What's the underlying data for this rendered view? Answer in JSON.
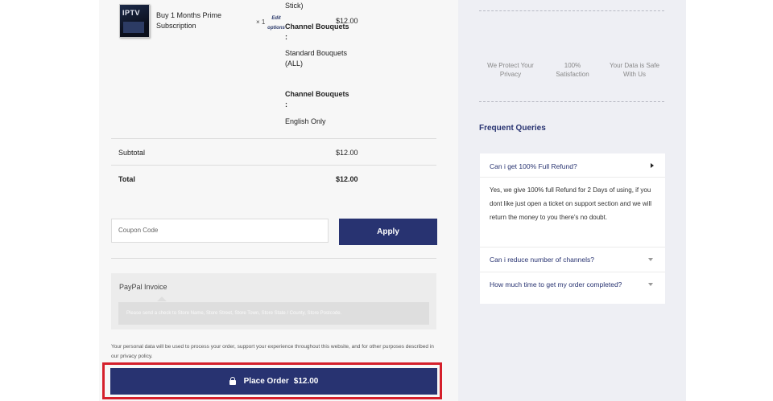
{
  "cart": {
    "product_image_text": "IPTV",
    "product_name": "Buy 1 Months Prime Subscription",
    "quantity": "× 1",
    "edit_options": "Edit options",
    "price": "$12.00",
    "meta_top": "Stick)",
    "meta_label_1": "Channel Bouquets :",
    "meta_value_1": "Standard Bouquets (ALL)",
    "meta_label_2": "Channel Bouquets :",
    "meta_value_2": "English Only"
  },
  "totals": {
    "subtotal_label": "Subtotal",
    "subtotal_value": "$12.00",
    "total_label": "Total",
    "total_value": "$12.00"
  },
  "coupon": {
    "placeholder": "Coupon Code",
    "apply_label": "Apply"
  },
  "payment": {
    "method_label": "PayPal Invoice",
    "instruction": "Please send a check to Store Name, Store Street, Store Town, Store State / County, Store Postcode."
  },
  "privacy_text": "Your personal data will be used to process your order, support your experience throughout this website, and for other purposes described in our privacy policy.",
  "place_order": {
    "label": "Place Order",
    "amount": "$12.00"
  },
  "features": [
    {
      "text": "We Protect Your Privacy"
    },
    {
      "text": "100% Satisfaction"
    },
    {
      "text": "Your Data is Safe With Us"
    }
  ],
  "faq": {
    "title": "Frequent Queries",
    "items": [
      {
        "question": "Can i get 100% Full Refund?",
        "answer": "Yes, we give 100% full Refund for 2 Days of using, if you dont like just open a ticket on support section and we will return the money to you there's no doubt."
      },
      {
        "question": "Can i reduce number of channels?"
      },
      {
        "question": "How much time to get my order completed?"
      }
    ]
  },
  "colors": {
    "primary": "#283371",
    "highlight": "#d5202b",
    "panel": "#eeeff4"
  }
}
